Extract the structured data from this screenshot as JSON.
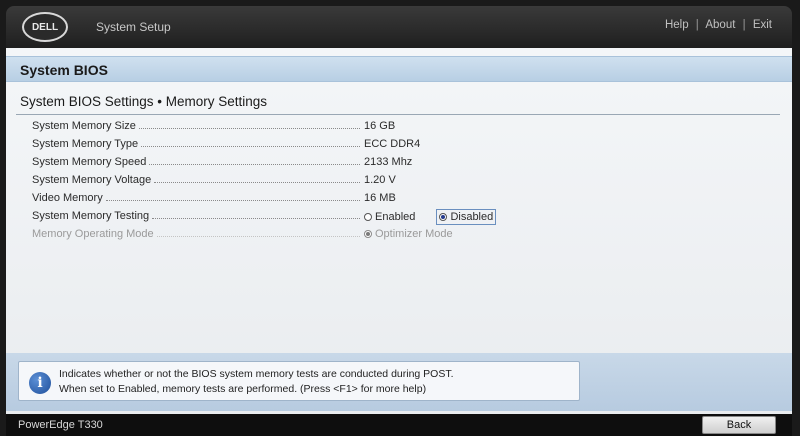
{
  "header": {
    "logo_text": "DELL",
    "app_title": "System Setup",
    "links": [
      "Help",
      "About",
      "Exit"
    ],
    "separator": "|"
  },
  "section": {
    "title": "System BIOS",
    "subtitle": "System BIOS Settings • Memory Settings"
  },
  "settings": [
    {
      "label": "System Memory Size",
      "value": "16 GB"
    },
    {
      "label": "System Memory Type",
      "value": "ECC DDR4"
    },
    {
      "label": "System Memory Speed",
      "value": "2133 Mhz"
    },
    {
      "label": "System Memory Voltage",
      "value": "1.20 V"
    },
    {
      "label": "Video Memory",
      "value": "16 MB"
    },
    {
      "label": "System Memory Testing",
      "options": [
        "Enabled",
        "Disabled"
      ],
      "selected": "Disabled"
    },
    {
      "label": "Memory Operating Mode",
      "options": [
        "Optimizer Mode"
      ],
      "selected": "Optimizer Mode",
      "disabled": true
    }
  ],
  "help": {
    "line1": "Indicates whether or not the BIOS system memory tests are conducted during POST.",
    "line2": "When set to Enabled, memory tests are performed. (Press <F1> for more help)"
  },
  "footer": {
    "model": "PowerEdge T330",
    "back_label": "Back"
  },
  "colors": {
    "header_bg": "#2a2a2a",
    "band_blue": "#c4d7ea",
    "radio_selected": "#243a8c"
  }
}
